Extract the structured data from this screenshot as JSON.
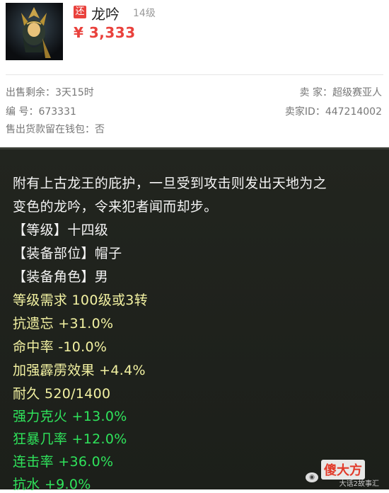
{
  "item": {
    "badge": "还",
    "name": "龙吟",
    "level": "14级",
    "price": "¥ 3,333"
  },
  "info": {
    "time_left": "出售剩余：3天15时",
    "seller": "卖  家：超级赛亚人",
    "serial": "编  号：673331",
    "seller_id": "卖家ID：447214002",
    "wallet": "售出货款留在钱包：否"
  },
  "details": {
    "description_1": "附有上古龙王的庇护，一旦受到攻击则发出天地为之",
    "description_2": "变色的龙吟，令来犯者闻而却步。",
    "grade": "【等级】十四级",
    "slot": "【装备部位】帽子",
    "role": "【装备角色】男",
    "requirement": "等级需求 100级或3转",
    "stat_1": "抗遗忘 +31.0%",
    "stat_2": "命中率 -10.0%",
    "stat_3": "加强霹雳效果 +4.4%",
    "durability": "耐久 520/1400",
    "green_1": "强力克火 +13.0%",
    "green_2": "狂暴几率 +12.0%",
    "green_3": "连击率 +36.0%",
    "green_4": "抗水 +9.0%"
  },
  "watermark": {
    "logo": "傻大方",
    "text": "大话2故事汇"
  },
  "colors": {
    "accent": "#e9413c",
    "panel_bg": "#1f221d",
    "stat_yellow": "#f3f2a2",
    "stat_green": "#2fe35b"
  },
  "icons": {
    "thumbnail": "helmet-item-image"
  }
}
